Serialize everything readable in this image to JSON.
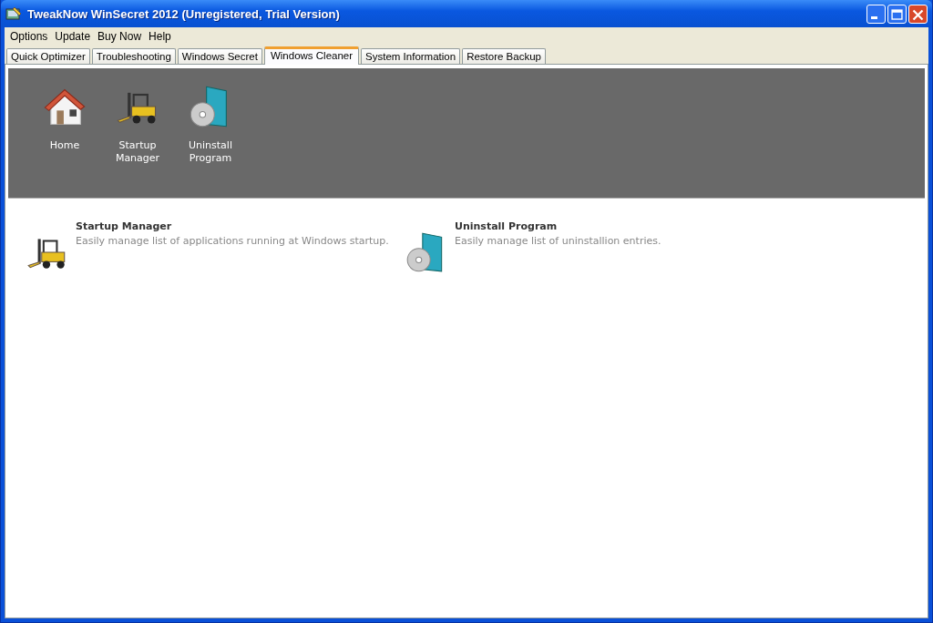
{
  "window": {
    "title": "TweakNow WinSecret 2012 (Unregistered, Trial Version)"
  },
  "menu": [
    "Options",
    "Update",
    "Buy Now",
    "Help"
  ],
  "tabs": [
    {
      "label": "Quick Optimizer",
      "selected": false
    },
    {
      "label": "Troubleshooting",
      "selected": false
    },
    {
      "label": "Windows Secret",
      "selected": false
    },
    {
      "label": "Windows Cleaner",
      "selected": true
    },
    {
      "label": "System Information",
      "selected": false
    },
    {
      "label": "Restore Backup",
      "selected": false
    }
  ],
  "toolbar": [
    {
      "kind": "home",
      "label": "Home"
    },
    {
      "kind": "forklift",
      "label": "Startup Manager"
    },
    {
      "kind": "box",
      "label": "Uninstall Program"
    }
  ],
  "features": [
    {
      "kind": "forklift",
      "title": "Startup Manager",
      "description": "Easily manage list of applications running at Windows startup."
    },
    {
      "kind": "box",
      "title": "Uninstall Program",
      "description": "Easily manage list of uninstallion entries."
    }
  ]
}
